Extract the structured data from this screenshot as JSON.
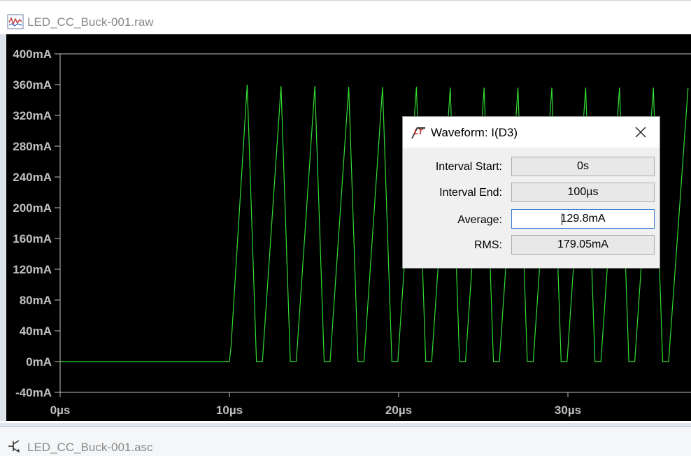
{
  "waveform_window": {
    "title": "LED_CC_Buck-001.raw",
    "trace_color": "#33dd33",
    "background_color": "#000000",
    "axis_color": "#c0c0c0"
  },
  "schematic_window": {
    "title": "LED_CC_Buck-001.asc"
  },
  "chart_data": {
    "type": "line",
    "title": "",
    "xlabel": "",
    "ylabel": "",
    "xlim": [
      0,
      37
    ],
    "ylim": [
      -40,
      400
    ],
    "x_ticks": [
      "0µs",
      "10µs",
      "20µs",
      "30µs"
    ],
    "y_ticks": [
      "400mA",
      "360mA",
      "320mA",
      "280mA",
      "240mA",
      "200mA",
      "160mA",
      "120mA",
      "80mA",
      "40mA",
      "0mA",
      "-40mA"
    ],
    "x_tick_values": [
      0,
      10,
      20,
      30
    ],
    "y_tick_values": [
      400,
      360,
      320,
      280,
      240,
      200,
      160,
      120,
      80,
      40,
      0,
      -40
    ],
    "series": [
      {
        "values_unit": "mA vs µs",
        "x": [
          0,
          10.0,
          10.1,
          11.05,
          11.6,
          11.95,
          13.05,
          13.6,
          13.95,
          15.05,
          15.6,
          15.95,
          17.05,
          17.6,
          17.95,
          19.05,
          19.6,
          19.95,
          21.05,
          21.6,
          21.95,
          23.05,
          23.6,
          23.95,
          25.05,
          25.6,
          25.95,
          27.05,
          27.6,
          27.95,
          29.05,
          29.6,
          29.95,
          31.05,
          31.6,
          31.95,
          33.05,
          33.6,
          33.95,
          35.05,
          35.6,
          35.95,
          37.1
        ],
        "y": [
          0,
          0,
          20,
          360,
          0,
          0,
          358,
          0,
          0,
          358,
          0,
          0,
          357,
          0,
          0,
          357,
          0,
          0,
          357,
          0,
          0,
          356,
          0,
          0,
          356,
          0,
          0,
          356,
          0,
          0,
          356,
          0,
          0,
          356,
          0,
          0,
          356,
          0,
          0,
          356,
          0,
          0,
          356
        ]
      }
    ]
  },
  "dialog": {
    "title": "Waveform: I(D3)",
    "close_icon": "close-icon",
    "rows": [
      {
        "label": "Interval Start:",
        "value": "0s"
      },
      {
        "label": "Interval End:",
        "value": "100µs"
      },
      {
        "label": "Average:",
        "value": "129.8mA"
      },
      {
        "label": "RMS:",
        "value": "179.05mA"
      }
    ]
  }
}
